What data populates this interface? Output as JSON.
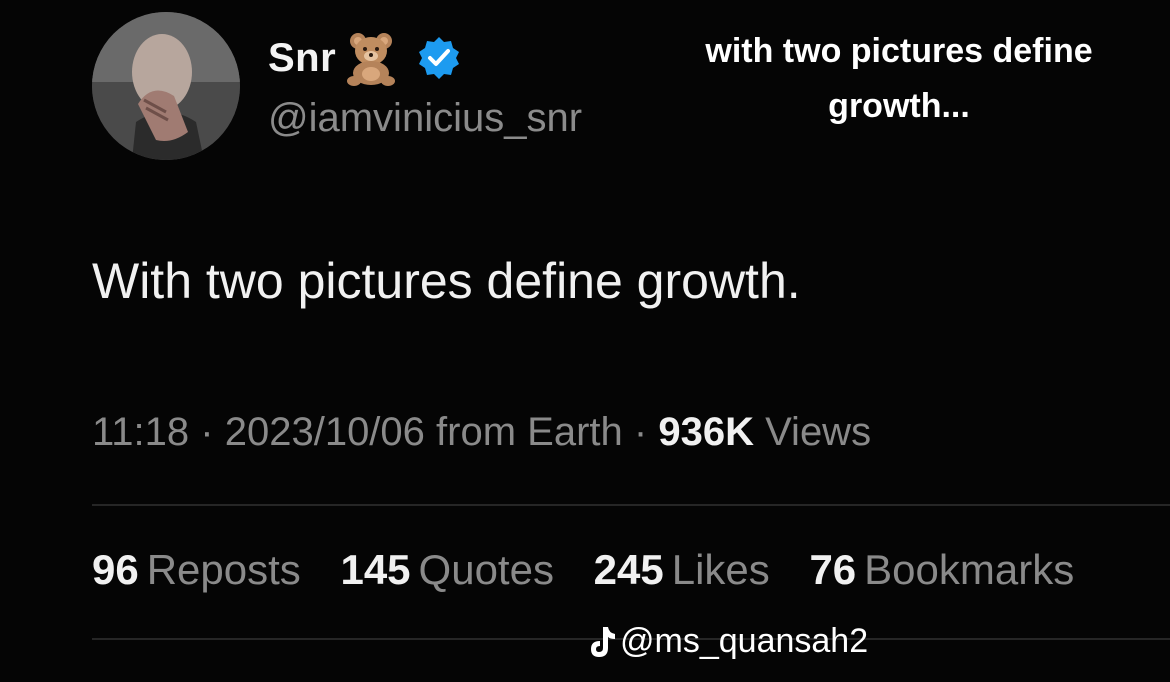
{
  "tweet": {
    "display_name": "Snr",
    "name_emoji_icon": "teddy-bear-icon",
    "verified_icon": "verified-badge-icon",
    "handle": "@iamvinicius_snr",
    "text": "With two pictures define growth.",
    "time": "11:18",
    "separator": "·",
    "date": "2023/10/06",
    "source": "from Earth",
    "views_count": "936K",
    "views_label": "Views"
  },
  "overlay": {
    "caption": "with two pictures define growth..."
  },
  "stats": [
    {
      "count": "96",
      "label": "Reposts"
    },
    {
      "count": "145",
      "label": "Quotes"
    },
    {
      "count": "245",
      "label": "Likes"
    },
    {
      "count": "76",
      "label": "Bookmarks"
    }
  ],
  "watermark": {
    "icon": "tiktok-icon",
    "text": "@ms_quansah2"
  },
  "colors": {
    "background": "#050505",
    "verified": "#1d9bf0",
    "muted": "#8a8a8a"
  }
}
